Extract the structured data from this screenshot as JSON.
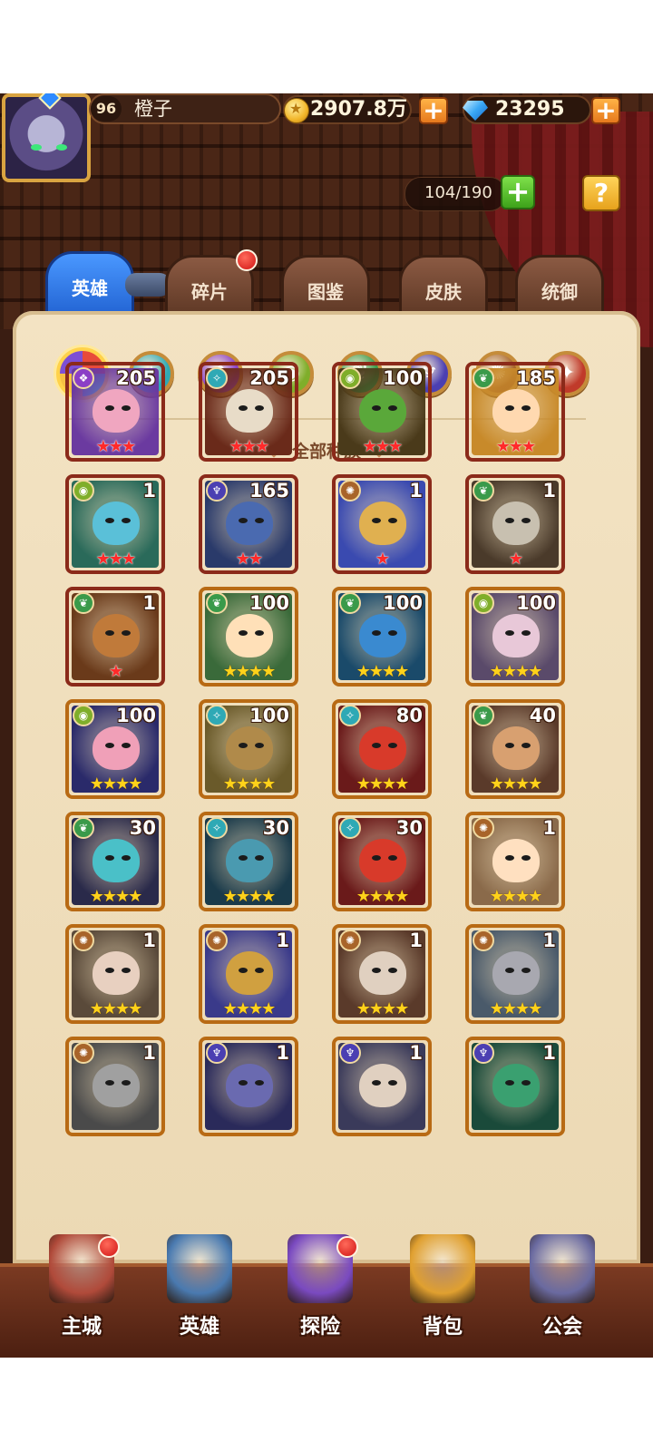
{
  "player": {
    "level": "96",
    "name": "橙子"
  },
  "resources": {
    "gold": "2907.8万",
    "diamonds": "23295"
  },
  "hero_capacity": "104/190",
  "help_label": "?",
  "add_label": "+",
  "tabs": [
    {
      "label": "英雄",
      "active": true
    },
    {
      "label": "碎片",
      "badge": true
    },
    {
      "label": "图鉴"
    },
    {
      "label": "皮肤"
    },
    {
      "label": "统御"
    }
  ],
  "race_filters": [
    {
      "name": "all",
      "color": "#ffd24a",
      "selected": true
    },
    {
      "name": "forest",
      "color": "#2fa9b5"
    },
    {
      "name": "dark",
      "color": "#8b3fc6"
    },
    {
      "name": "nature",
      "color": "#7fae2a"
    },
    {
      "name": "plant",
      "color": "#3a9a4a"
    },
    {
      "name": "abyss",
      "color": "#4b3fb2"
    },
    {
      "name": "light",
      "color": "#a8642a"
    },
    {
      "name": "chaos",
      "color": "#c03a2a"
    }
  ],
  "filter_title": "全部种族",
  "heroes": [
    {
      "level": "205",
      "stars": "★★★",
      "star_color": "red",
      "race_icon": "dark",
      "race_color": "#8b3fc6",
      "bg": "#6b3aa0",
      "face": "#f0a6c0",
      "frame": "red"
    },
    {
      "level": "205",
      "stars": "★★★",
      "star_color": "red",
      "race_icon": "forest",
      "race_color": "#2fa9b5",
      "bg": "#6a2a1a",
      "face": "#e8dcc8",
      "frame": "red"
    },
    {
      "level": "100",
      "stars": "★★★",
      "star_color": "red",
      "race_icon": "nature",
      "race_color": "#7fae2a",
      "bg": "#4a3a1a",
      "face": "#5aa83a",
      "frame": "red"
    },
    {
      "level": "185",
      "stars": "★★★",
      "star_color": "red",
      "race_icon": "plant",
      "race_color": "#3a9a4a",
      "bg": "#c88a2a",
      "face": "#ffd9b0",
      "frame": "red"
    },
    {
      "level": "1",
      "stars": "★★★",
      "star_color": "red",
      "race_icon": "nature",
      "race_color": "#7fae2a",
      "bg": "#2a6a5a",
      "face": "#5ac0d8",
      "frame": "red"
    },
    {
      "level": "165",
      "stars": "★★",
      "star_color": "red",
      "race_icon": "abyss",
      "race_color": "#4b3fb2",
      "bg": "#2a3a6a",
      "face": "#4a6ab0",
      "frame": "red"
    },
    {
      "level": "1",
      "stars": "★",
      "star_color": "red",
      "race_icon": "light",
      "race_color": "#a8642a",
      "bg": "#3a4ab0",
      "face": "#e0b050",
      "frame": "red"
    },
    {
      "level": "1",
      "stars": "★",
      "star_color": "red",
      "race_icon": "plant",
      "race_color": "#3a9a4a",
      "bg": "#4a3a2a",
      "face": "#c8c0b0",
      "frame": "red"
    },
    {
      "level": "1",
      "stars": "★",
      "star_color": "red",
      "race_icon": "plant",
      "race_color": "#3a9a4a",
      "bg": "#6a3a1a",
      "face": "#c07a3a",
      "frame": "red"
    },
    {
      "level": "100",
      "stars": "★★★★",
      "star_color": "yel",
      "race_icon": "plant",
      "race_color": "#3a9a4a",
      "bg": "#3a6a3a",
      "face": "#ffe0b8",
      "frame": "gold"
    },
    {
      "level": "100",
      "stars": "★★★★",
      "star_color": "yel",
      "race_icon": "plant",
      "race_color": "#3a9a4a",
      "bg": "#1a4a6a",
      "face": "#3a8ad0",
      "frame": "gold"
    },
    {
      "level": "100",
      "stars": "★★★★",
      "star_color": "yel",
      "race_icon": "nature",
      "race_color": "#7fae2a",
      "bg": "#5a4a6a",
      "face": "#e8c8d8",
      "frame": "gold"
    },
    {
      "level": "100",
      "stars": "★★★★",
      "star_color": "yel",
      "race_icon": "nature",
      "race_color": "#7fae2a",
      "bg": "#2a2a6a",
      "face": "#f0a0b8",
      "frame": "gold"
    },
    {
      "level": "100",
      "stars": "★★★★",
      "star_color": "yel",
      "race_icon": "forest",
      "race_color": "#2fa9b5",
      "bg": "#6a5a2a",
      "face": "#b08a4a",
      "frame": "gold"
    },
    {
      "level": "80",
      "stars": "★★★★",
      "star_color": "yel",
      "race_icon": "forest",
      "race_color": "#2fa9b5",
      "bg": "#6a1a1a",
      "face": "#d83a2a",
      "frame": "gold"
    },
    {
      "level": "40",
      "stars": "★★★★",
      "star_color": "yel",
      "race_icon": "plant",
      "race_color": "#3a9a4a",
      "bg": "#5a3a2a",
      "face": "#d8a070",
      "frame": "gold"
    },
    {
      "level": "30",
      "stars": "★★★★",
      "star_color": "yel",
      "race_icon": "plant",
      "race_color": "#3a9a4a",
      "bg": "#2a2a4a",
      "face": "#4ac0c8",
      "frame": "gold"
    },
    {
      "level": "30",
      "stars": "★★★★",
      "star_color": "yel",
      "race_icon": "forest",
      "race_color": "#2fa9b5",
      "bg": "#1a3a4a",
      "face": "#4a9ab0",
      "frame": "gold"
    },
    {
      "level": "30",
      "stars": "★★★★",
      "star_color": "yel",
      "race_icon": "forest",
      "race_color": "#2fa9b5",
      "bg": "#6a1a1a",
      "face": "#d83a2a",
      "frame": "gold"
    },
    {
      "level": "1",
      "stars": "★★★★",
      "star_color": "yel",
      "race_icon": "light",
      "race_color": "#a8642a",
      "bg": "#8a6a4a",
      "face": "#ffe0c0",
      "frame": "gold"
    },
    {
      "level": "1",
      "stars": "★★★★",
      "star_color": "yel",
      "race_icon": "light",
      "race_color": "#a8642a",
      "bg": "#5a4a3a",
      "face": "#e8d0c0",
      "frame": "gold"
    },
    {
      "level": "1",
      "stars": "★★★★",
      "star_color": "yel",
      "race_icon": "light",
      "race_color": "#a8642a",
      "bg": "#3a3a8a",
      "face": "#d0a040",
      "frame": "gold"
    },
    {
      "level": "1",
      "stars": "★★★★",
      "star_color": "yel",
      "race_icon": "light",
      "race_color": "#a8642a",
      "bg": "#5a3a2a",
      "face": "#e0d0c0",
      "frame": "gold"
    },
    {
      "level": "1",
      "stars": "★★★★",
      "star_color": "yel",
      "race_icon": "light",
      "race_color": "#a8642a",
      "bg": "#4a5a6a",
      "face": "#a8a8b0",
      "frame": "gold"
    },
    {
      "level": "1",
      "stars": "",
      "star_color": "yel",
      "race_icon": "light",
      "race_color": "#a8642a",
      "bg": "#4a4a4a",
      "face": "#a0a0a0",
      "frame": "gold"
    },
    {
      "level": "1",
      "stars": "",
      "star_color": "yel",
      "race_icon": "abyss",
      "race_color": "#4b3fb2",
      "bg": "#2a2a5a",
      "face": "#6a6ab0",
      "frame": "gold"
    },
    {
      "level": "1",
      "stars": "",
      "star_color": "yel",
      "race_icon": "abyss",
      "race_color": "#4b3fb2",
      "bg": "#3a3a5a",
      "face": "#e0d0c0",
      "frame": "gold"
    },
    {
      "level": "1",
      "stars": "",
      "star_color": "yel",
      "race_icon": "abyss",
      "race_color": "#4b3fb2",
      "bg": "#1a4a3a",
      "face": "#3aa070",
      "frame": "gold"
    }
  ],
  "nav": [
    {
      "label": "主城",
      "icon": "castle-icon",
      "color": "#b04a3a",
      "badge": true
    },
    {
      "label": "英雄",
      "icon": "hero-icon",
      "color": "#4a7ab0",
      "badge": false
    },
    {
      "label": "探险",
      "icon": "portal-icon",
      "color": "#7a4ac0",
      "badge": true
    },
    {
      "label": "背包",
      "icon": "bag-icon",
      "color": "#e0a030",
      "badge": false
    },
    {
      "label": "公会",
      "icon": "guild-icon",
      "color": "#6a6aa0",
      "badge": false
    }
  ]
}
